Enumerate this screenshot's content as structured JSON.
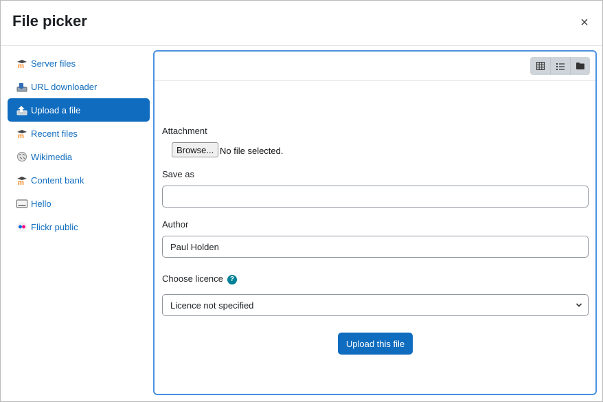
{
  "dialog": {
    "title": "File picker",
    "close_symbol": "×"
  },
  "sidebar": {
    "items": [
      {
        "label": "Server files",
        "icon": "moodle-icon"
      },
      {
        "label": "URL downloader",
        "icon": "url-download-icon"
      },
      {
        "label": "Upload a file",
        "icon": "upload-icon",
        "active": true
      },
      {
        "label": "Recent files",
        "icon": "moodle-icon"
      },
      {
        "label": "Wikimedia",
        "icon": "wikimedia-globe-icon"
      },
      {
        "label": "Content bank",
        "icon": "moodle-icon"
      },
      {
        "label": "Hello",
        "icon": "hello-keyboard-icon"
      },
      {
        "label": "Flickr public",
        "icon": "flickr-icon"
      }
    ]
  },
  "toolbar": {
    "views": [
      "grid-view-icon",
      "list-view-icon",
      "folder-view-icon"
    ]
  },
  "form": {
    "attachment_label": "Attachment",
    "browse_label": "Browse...",
    "no_file_text": "No file selected.",
    "save_as_label": "Save as",
    "save_as_value": "",
    "author_label": "Author",
    "author_value": "Paul Holden",
    "licence_label": "Choose licence",
    "help_symbol": "?",
    "licence_selected": "Licence not specified",
    "upload_label": "Upload this file"
  },
  "colors": {
    "accent": "#0f6cbf",
    "panel_border": "#4a90e2",
    "help": "#008196",
    "moodle_orange": "#f98012"
  }
}
